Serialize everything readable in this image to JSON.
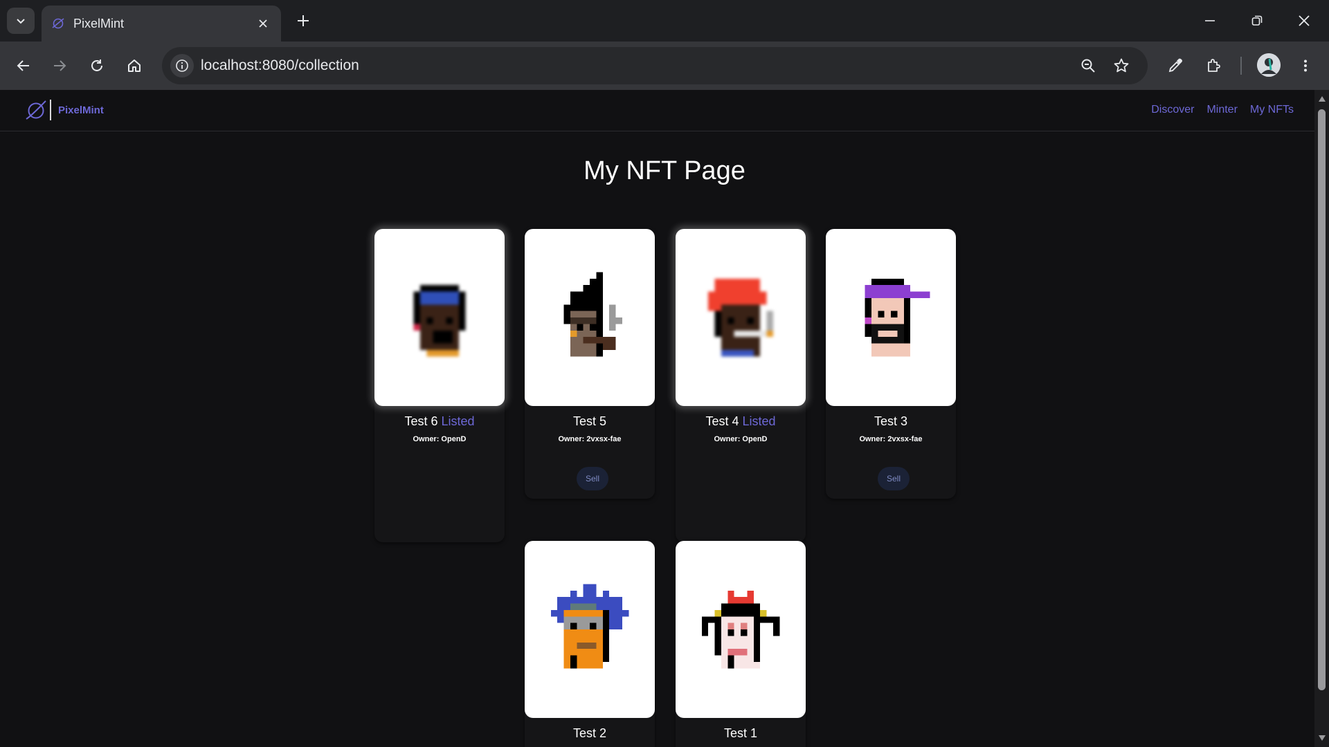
{
  "browser": {
    "tab_title": "PixelMint",
    "url": "localhost:8080/collection"
  },
  "site": {
    "brand": "PixelMint",
    "nav": [
      "Discover",
      "Minter",
      "My NFTs"
    ]
  },
  "page": {
    "title": "My NFT Page"
  },
  "nfts": [
    {
      "name": "Test 6",
      "status": "Listed",
      "owner": "Owner: OpenD",
      "sell": "",
      "image": "pixel-punk-blue-bandana",
      "blurred": true
    },
    {
      "name": "Test 5",
      "status": "",
      "owner": "Owner: 2vxsx-fae",
      "sell": "Sell",
      "image": "pixel-punk-black-hair-smoke",
      "blurred": false
    },
    {
      "name": "Test 4",
      "status": "Listed",
      "owner": "Owner: OpenD",
      "sell": "",
      "image": "pixel-punk-red-hair-cigarette",
      "blurred": true
    },
    {
      "name": "Test 3",
      "status": "",
      "owner": "Owner: 2vxsx-fae",
      "sell": "Sell",
      "image": "pixel-punk-purple-cap",
      "blurred": false
    },
    {
      "name": "Test 2",
      "status": "",
      "owner": "",
      "sell": "",
      "image": "pixel-punk-blue-wild-hair",
      "blurred": false
    },
    {
      "name": "Test 1",
      "status": "",
      "owner": "",
      "sell": "",
      "image": "pixel-punk-red-bow",
      "blurred": false
    }
  ],
  "colors": {
    "accent": "#6d68d6",
    "background": "#111113",
    "card_image_bg": "#ffffff"
  }
}
